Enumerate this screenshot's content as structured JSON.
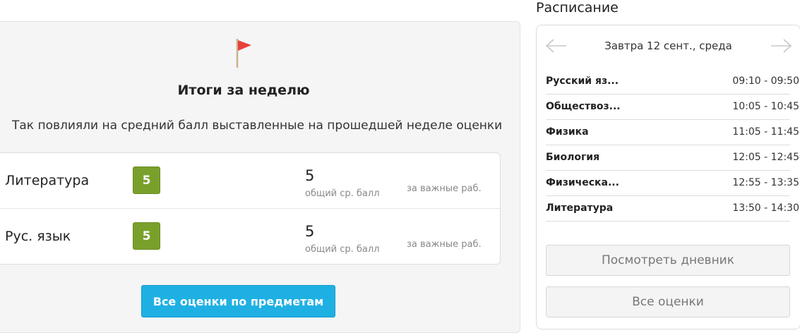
{
  "summary": {
    "title": "Итоги за неделю",
    "description": "Так повлияли на средний балл выставленные на прошедшей неделе оценки",
    "grades": [
      {
        "subject": "Литература",
        "grade": "5",
        "average": "5",
        "average_label": "общий ср. балл",
        "important_label": "за важные раб."
      },
      {
        "subject": "Рус. язык",
        "grade": "5",
        "average": "5",
        "average_label": "общий ср. балл",
        "important_label": "за важные раб."
      }
    ],
    "all_grades_button": "Все оценки по предметам"
  },
  "schedule": {
    "heading": "Расписание",
    "day": "Завтра 12 сент., среда",
    "lessons": [
      {
        "name": "Русский яз...",
        "time": "09:10 - 09:50"
      },
      {
        "name": "Обществоз...",
        "time": "10:05 - 10:45"
      },
      {
        "name": "Физика",
        "time": "11:05 - 11:45"
      },
      {
        "name": "Биология",
        "time": "12:05 - 12:45"
      },
      {
        "name": "Физическа...",
        "time": "12:55 - 13:35"
      },
      {
        "name": "Литература",
        "time": "13:50 - 14:30"
      }
    ],
    "diary_button": "Посмотреть дневник",
    "all_grades_button": "Все оценки"
  },
  "colors": {
    "grade_badge": "#79a02a",
    "primary_button": "#1fb0e3",
    "flag": "#e8423a"
  },
  "icons": {
    "flag": "flag-icon",
    "prev": "arrow-left-icon",
    "next": "arrow-right-icon"
  }
}
